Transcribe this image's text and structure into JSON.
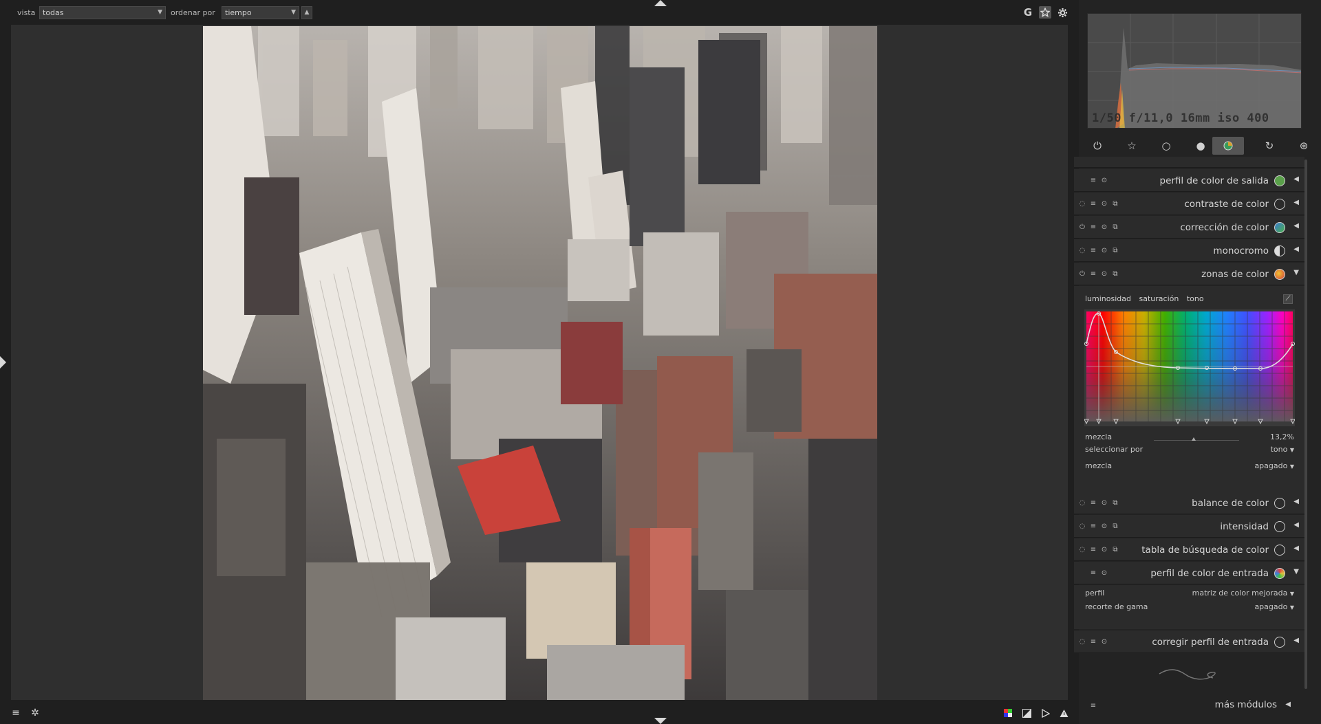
{
  "topbar": {
    "view_label": "vista",
    "view_value": "todas",
    "sort_label": "ordenar por",
    "sort_value": "tiempo",
    "sort_dir_icon": "▲",
    "icons": [
      "grouping-icon",
      "star-icon",
      "gear-icon"
    ],
    "grouping_glyph": "G"
  },
  "histogram": {
    "exif": "1/50 f/11,0 16mm iso 400"
  },
  "module_groups": [
    "power-icon",
    "favorite-icon",
    "basic-icon",
    "tone-icon",
    "color-icon",
    "correct-icon",
    "effect-icon"
  ],
  "modules": [
    {
      "name": "perfil de color de salida",
      "icon_color": "#7cb35a"
    },
    {
      "name": "contraste de color"
    },
    {
      "name": "corrección de color"
    },
    {
      "name": "monocromo"
    },
    {
      "name": "zonas de color"
    },
    {
      "name": "balance de color"
    },
    {
      "name": "intensidad"
    },
    {
      "name": "tabla de búsqueda de color"
    },
    {
      "name": "perfil de color de entrada"
    },
    {
      "name": "corregir perfil de entrada"
    }
  ],
  "colorzones": {
    "tabs": [
      "luminosidad",
      "saturación",
      "tono"
    ],
    "mix_label": "mezcla",
    "mix_value": "13,2%",
    "mix_fraction": 0.47,
    "select_label": "seleccionar por",
    "select_value": "tono",
    "blend_label": "mezcla",
    "blend_value": "apagado"
  },
  "input_profile": {
    "profile_label": "perfil",
    "profile_value": "matriz de color mejorada",
    "gamut_label": "recorte de gama",
    "gamut_value": "apagado"
  },
  "more_modules": "más módulos",
  "bottombar": {
    "left_icons": [
      "menu-icon",
      "styles-icon"
    ],
    "right_icons": [
      "color-assessment-icon",
      "overexposed-icon",
      "softproof-icon",
      "gamut-check-icon"
    ]
  }
}
